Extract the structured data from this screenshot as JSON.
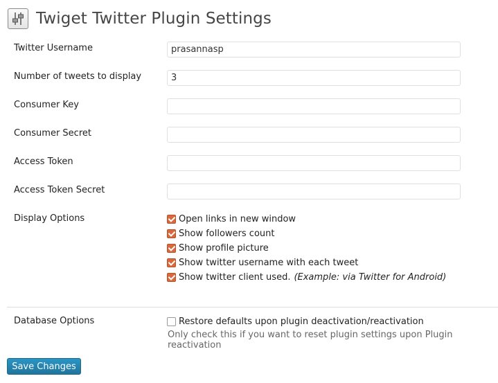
{
  "header": {
    "title": "Twiget Twitter Plugin Settings"
  },
  "fields": [
    {
      "label": "Twitter Username",
      "value": "prasannasp"
    },
    {
      "label": "Number of tweets to display",
      "value": "3"
    },
    {
      "label": "Consumer Key",
      "value": ""
    },
    {
      "label": "Consumer Secret",
      "value": ""
    },
    {
      "label": "Access Token",
      "value": ""
    },
    {
      "label": "Access Token Secret",
      "value": ""
    }
  ],
  "display_options": {
    "label": "Display Options",
    "items": [
      {
        "label": "Open links in new window",
        "checked": true
      },
      {
        "label": "Show followers count",
        "checked": true
      },
      {
        "label": "Show profile picture",
        "checked": true
      },
      {
        "label": "Show twitter username with each tweet",
        "checked": true
      },
      {
        "label": "Show twitter client used.",
        "example": "(Example: via Twitter for Android)",
        "checked": true
      }
    ]
  },
  "database_options": {
    "label": "Database Options",
    "checkbox_label": "Restore defaults upon plugin deactivation/reactivation",
    "checked": false,
    "helper": "Only check this if you want to reset plugin settings upon Plugin reactivation"
  },
  "save_button": {
    "label": "Save Changes"
  },
  "colors": {
    "accent": "#21759b",
    "checkbox": "#d9683c"
  },
  "icons": {
    "header": "settings-sliders-icon"
  }
}
